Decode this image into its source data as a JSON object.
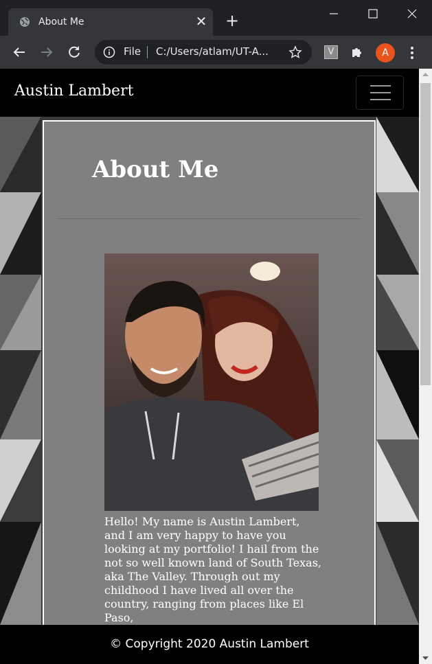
{
  "browser": {
    "tab_title": "About Me",
    "new_tab_symbol": "+",
    "close_symbol": "✕",
    "omnibox": {
      "scheme": "File",
      "url": "C:/Users/atlam/UT-A..."
    },
    "extension_label": "V",
    "profile_initial": "A"
  },
  "site": {
    "brand": "Austin Lambert",
    "page_heading": "About Me",
    "bio": "Hello! My name is Austin Lambert, and I am very happy to have you looking at my portfolio! I hail from the not so well known land of South Texas, aka The Valley. Through out my childhood I have lived all over the country, ranging from places like El Paso,",
    "footer": "© Copyright 2020 Austin Lambert"
  },
  "colors": {
    "chrome_dark": "#202124",
    "chrome_toolbar": "#35363a",
    "nav_bg": "#000000",
    "card_bg": "#808080",
    "profile": "#e8541b"
  }
}
